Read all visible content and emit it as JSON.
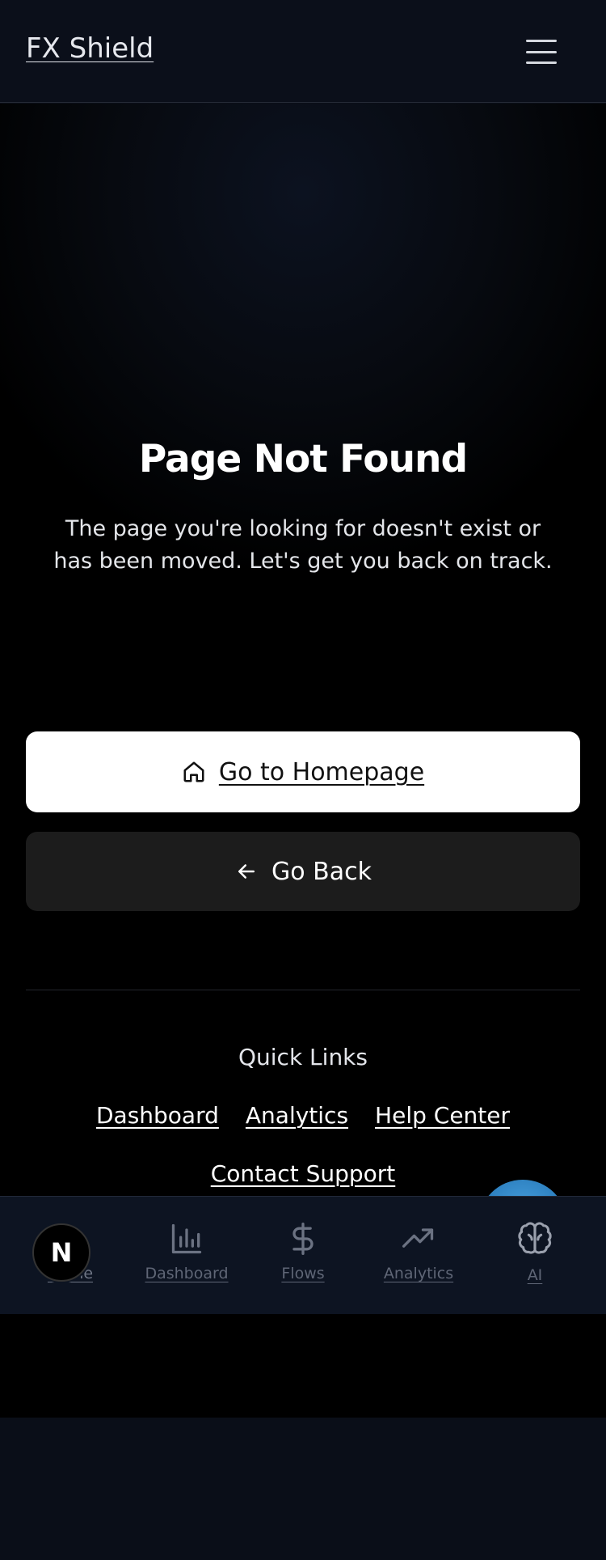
{
  "header": {
    "brand": "FX Shield",
    "menu_icon": "hamburger-menu-icon"
  },
  "main": {
    "title": "Page Not Found",
    "subtitle": "The page you're looking for doesn't exist or has been moved. Let's get you back on track.",
    "home_button": {
      "icon": "home-icon",
      "label": "Go to Homepage"
    },
    "back_button": {
      "icon": "arrow-left-icon",
      "label": "Go Back"
    }
  },
  "quick_links": {
    "title": "Quick Links",
    "links": [
      "Dashboard",
      "Analytics",
      "Help Center",
      "Contact Support"
    ]
  },
  "bottom_nav": {
    "items": [
      {
        "label": "Home",
        "icon": "home-icon"
      },
      {
        "label": "Dashboard",
        "icon": "bar-chart-icon"
      },
      {
        "label": "Flows",
        "icon": "dollar-icon"
      },
      {
        "label": "Analytics",
        "icon": "trending-up-icon"
      },
      {
        "label": "AI",
        "icon": "brain-icon"
      }
    ]
  },
  "badge": {
    "letter": "N"
  },
  "colors": {
    "background": "#000000",
    "header_bg": "#0b0f1a",
    "primary_button_bg": "#ffffff",
    "secondary_button_bg": "#1c1c1c",
    "fab_accent": "#3a93d4"
  }
}
